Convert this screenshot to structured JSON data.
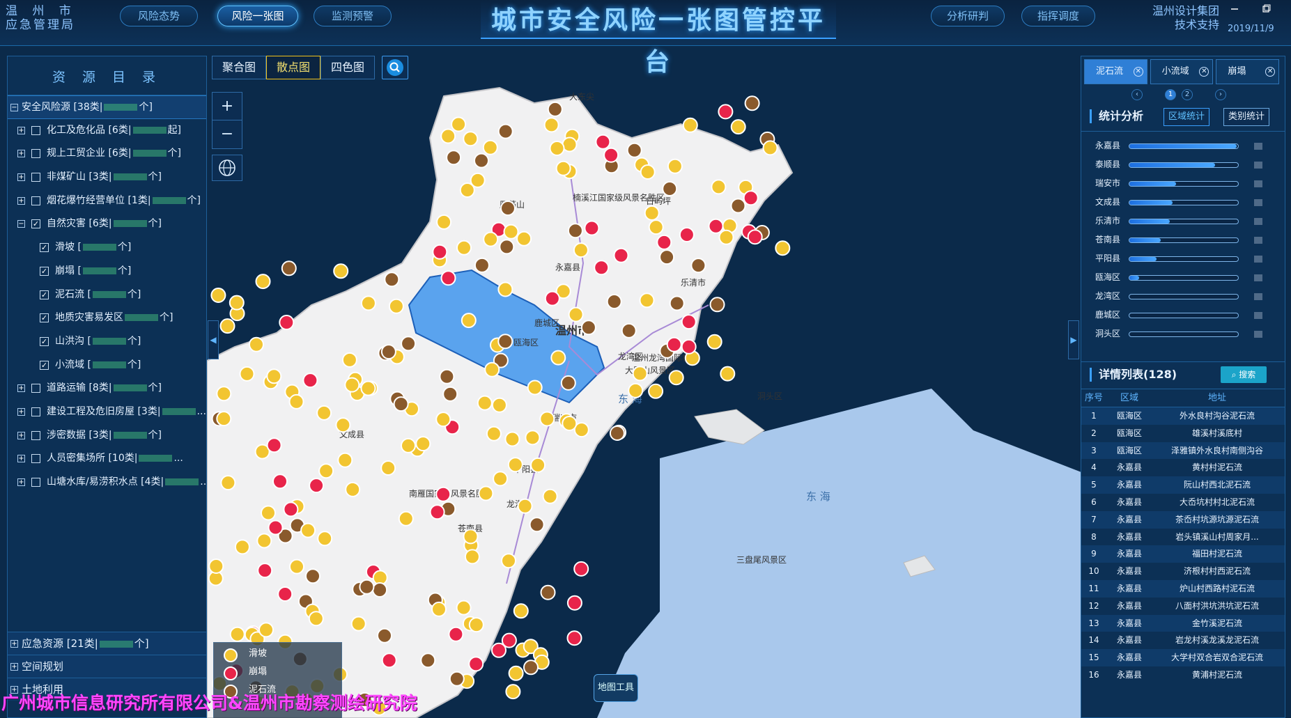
{
  "header": {
    "org_line1": "温 州 市",
    "org_line2": "应急管理局",
    "nav_left": [
      "风险态势",
      "风险一张图",
      "监测预警"
    ],
    "nav_active": 1,
    "title": "城市安全风险一张图管控平台",
    "nav_right": [
      "分析研判",
      "指挥调度"
    ],
    "support_line1": "温州设计集团",
    "support_line2": "技术支持",
    "date": "2019/11/9",
    "min_icon": "minimize-icon",
    "max_icon": "maximize-icon"
  },
  "left": {
    "title": "资 源 目 录",
    "tree": [
      {
        "label": "安全风险源 [38类|",
        "suffix": "个]",
        "level": 0,
        "expanded": true
      },
      {
        "label": "化工及危化品 [6类|",
        "suffix": "起]",
        "level": 1,
        "checked": false
      },
      {
        "label": "规上工贸企业 [6类|",
        "suffix": "个]",
        "level": 1,
        "checked": false
      },
      {
        "label": "非煤矿山 [3类|",
        "suffix": "个]",
        "level": 1,
        "checked": false
      },
      {
        "label": "烟花爆竹经营单位 [1类|",
        "suffix": "个]",
        "level": 1,
        "checked": false
      },
      {
        "label": "自然灾害 [6类|",
        "suffix": "个]",
        "level": 1,
        "checked": true,
        "expanded": true
      },
      {
        "label": "滑坡 [",
        "suffix": "个]",
        "level": 2,
        "checked": true
      },
      {
        "label": "崩塌 [",
        "suffix": "个]",
        "level": 2,
        "checked": true
      },
      {
        "label": "泥石流 [",
        "suffix": "个]",
        "level": 2,
        "checked": true
      },
      {
        "label": "地质灾害易发区",
        "suffix": "个]",
        "level": 2,
        "checked": true
      },
      {
        "label": "山洪沟 [",
        "suffix": "个]",
        "level": 2,
        "checked": true
      },
      {
        "label": "小流域 [",
        "suffix": "个]",
        "level": 2,
        "checked": true
      },
      {
        "label": "道路运输 [8类|",
        "suffix": "个]",
        "level": 1,
        "checked": false
      },
      {
        "label": "建设工程及危旧房屋 [3类|",
        "suffix": "...",
        "level": 1,
        "checked": false
      },
      {
        "label": "涉密数据 [3类|",
        "suffix": "个]",
        "level": 1,
        "checked": false
      },
      {
        "label": "人员密集场所 [10类|",
        "suffix": "...",
        "level": 1,
        "checked": false
      },
      {
        "label": "山塘水库/易涝积水点 [4类|",
        "suffix": "...",
        "level": 1,
        "checked": false
      }
    ],
    "groups": [
      {
        "label": "应急资源 [21类|",
        "suffix": "个]"
      },
      {
        "label": "空间规划",
        "suffix": ""
      },
      {
        "label": "土地利用",
        "suffix": ""
      }
    ]
  },
  "toolbar": {
    "views": [
      "聚合图",
      "散点图",
      "四色图"
    ],
    "active": 1,
    "search_icon": "search-icon",
    "zoom_in": "+",
    "zoom_out": "−",
    "globe_icon": "globe-icon"
  },
  "map": {
    "place_labels": [
      "大东尖",
      "永嘉县",
      "乐清市",
      "鹿城区",
      "温州市",
      "瓯海区",
      "龙湾区",
      "瑞安市",
      "洞头区",
      "平阳县",
      "文成县",
      "龙港",
      "苍南县",
      "东  海",
      "东  海",
      "温州龙湾国际机场",
      "大罗山风景区",
      "南雁国家级风景名胜区",
      "三盘尾风景区",
      "日屿坪",
      "雁荡山",
      "楠溪江国家级风景名胜区"
    ],
    "legend": [
      {
        "label": "滑坡",
        "color": "#f2c531"
      },
      {
        "label": "崩塌",
        "color": "#e8244a"
      },
      {
        "label": "泥石流",
        "color": "#8a5a2c"
      }
    ],
    "map_tools": "地图工具",
    "footer_watermark": "广州城市信息研究所有限公司&温州市勘察测绘研究院"
  },
  "right": {
    "tabs": [
      "泥石流",
      "小流域",
      "崩塌"
    ],
    "tab_active": 0,
    "pages": [
      "1",
      "2"
    ],
    "stats_title": "统计分析",
    "stats_buttons": [
      "区域统计",
      "类别统计"
    ],
    "stats": [
      {
        "name": "永嘉县",
        "ratio": 0.99
      },
      {
        "name": "泰顺县",
        "ratio": 0.79
      },
      {
        "name": "瑞安市",
        "ratio": 0.43
      },
      {
        "name": "文成县",
        "ratio": 0.4
      },
      {
        "name": "乐清市",
        "ratio": 0.37
      },
      {
        "name": "苍南县",
        "ratio": 0.29
      },
      {
        "name": "平阳县",
        "ratio": 0.25
      },
      {
        "name": "瓯海区",
        "ratio": 0.09
      },
      {
        "name": "龙湾区",
        "ratio": 0.0
      },
      {
        "name": "鹿城区",
        "ratio": 0.0
      },
      {
        "name": "洞头区",
        "ratio": 0.0
      }
    ],
    "list_title": "详情列表(128)",
    "list_search": "搜索",
    "list_columns": [
      "序号",
      "区域",
      "地址"
    ],
    "list": [
      [
        "1",
        "瓯海区",
        "外水良村沟谷泥石流"
      ],
      [
        "2",
        "瓯海区",
        "雄溪村溪底村"
      ],
      [
        "3",
        "瓯海区",
        "泽雅镇外水良村南侧沟谷"
      ],
      [
        "4",
        "永嘉县",
        "黄村村泥石流"
      ],
      [
        "5",
        "永嘉县",
        "阮山村西北泥石流"
      ],
      [
        "6",
        "永嘉县",
        "大岙坑村村北泥石流"
      ],
      [
        "7",
        "永嘉县",
        "茶岙村坑源坑源泥石流"
      ],
      [
        "8",
        "永嘉县",
        "岩头镇溪山村周家月..."
      ],
      [
        "9",
        "永嘉县",
        "福田村泥石流"
      ],
      [
        "10",
        "永嘉县",
        "济根村村西泥石流"
      ],
      [
        "11",
        "永嘉县",
        "炉山村西路村泥石流"
      ],
      [
        "12",
        "永嘉县",
        "八面村洪坑洪坑泥石流"
      ],
      [
        "13",
        "永嘉县",
        "金竹溪泥石流"
      ],
      [
        "14",
        "永嘉县",
        "岩龙村溪龙溪龙泥石流"
      ],
      [
        "15",
        "永嘉县",
        "大学村双合岩双合泥石流"
      ],
      [
        "16",
        "永嘉县",
        "黄浦村泥石流"
      ]
    ]
  },
  "colors": {
    "accent": "#3aa0ff",
    "slide": "#f2c531",
    "collapse": "#e8244a",
    "debris": "#8a5a2c",
    "land": "#f1f1f2",
    "sea": "#a9c8ec",
    "highlight": "#5aa3ee"
  }
}
